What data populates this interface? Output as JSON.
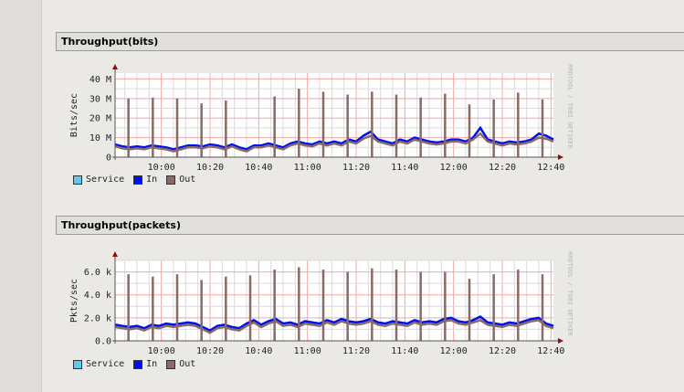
{
  "colors": {
    "service": "#5ec8f0",
    "in": "#0010f0",
    "out": "#8a6a66",
    "major_grid": "#f0a8a8",
    "minor_grid": "#dcdcdc",
    "axis": "#8a1010"
  },
  "watermark": "RRDTOOL / TOBI OETIKER",
  "legend": [
    {
      "key": "service",
      "label": "Service"
    },
    {
      "key": "in",
      "label": "In"
    },
    {
      "key": "out",
      "label": "Out"
    }
  ],
  "chart_data": [
    {
      "type": "line",
      "title": "Throughput(bits)",
      "ylabel": "Bits/sec",
      "xlim": [
        581,
        761
      ],
      "ylim": [
        0,
        43
      ],
      "yticks": [
        {
          "v": 0,
          "label": "0"
        },
        {
          "v": 10,
          "label": "10 M"
        },
        {
          "v": 20,
          "label": "20 M"
        },
        {
          "v": 30,
          "label": "30 M"
        },
        {
          "v": 40,
          "label": "40 M"
        }
      ],
      "xticks": [
        {
          "v": 600,
          "label": "10:00"
        },
        {
          "v": 620,
          "label": "10:20"
        },
        {
          "v": 640,
          "label": "10:40"
        },
        {
          "v": 660,
          "label": "11:00"
        },
        {
          "v": 680,
          "label": "11:20"
        },
        {
          "v": 700,
          "label": "11:40"
        },
        {
          "v": 720,
          "label": "12:00"
        },
        {
          "v": 740,
          "label": "12:20"
        },
        {
          "v": 760,
          "label": "12:40"
        }
      ],
      "x_start": 581,
      "x_step": 3,
      "in": [
        6.5,
        5.5,
        5,
        5.5,
        5,
        6,
        5.5,
        5,
        4,
        5,
        6,
        6,
        5.5,
        6.5,
        6,
        5,
        6.5,
        5,
        4,
        6,
        6,
        7,
        6,
        5,
        7,
        8,
        7,
        6.5,
        8,
        7,
        8,
        7,
        9,
        8,
        11,
        13,
        9,
        8,
        7,
        9,
        8,
        10,
        9,
        8,
        7.5,
        8,
        9,
        9,
        8,
        10,
        15,
        9,
        8,
        7,
        8,
        7.5,
        8,
        9,
        12,
        11,
        9
      ],
      "out": [
        5.5,
        4.5,
        4,
        4.5,
        4,
        5,
        4.5,
        4,
        3,
        4,
        5,
        5,
        4.5,
        5.5,
        5,
        4,
        5.5,
        4,
        3,
        5,
        5,
        6,
        5,
        4,
        6,
        7,
        6,
        5.5,
        7,
        6,
        7,
        6,
        8,
        7,
        9.5,
        11,
        8,
        7,
        6,
        8,
        7,
        9,
        8,
        7,
        6.5,
        7,
        8,
        8,
        7,
        9,
        12,
        8,
        7,
        6,
        7,
        6.5,
        7,
        8,
        10,
        9.5,
        8
      ],
      "spikes": [
        {
          "t": 586.5,
          "v": 30
        },
        {
          "t": 596.5,
          "v": 30.5
        },
        {
          "t": 606.5,
          "v": 30
        },
        {
          "t": 616.5,
          "v": 27.5
        },
        {
          "t": 626.5,
          "v": 29
        },
        {
          "t": 646.5,
          "v": 31
        },
        {
          "t": 656.5,
          "v": 35
        },
        {
          "t": 666.5,
          "v": 33.5
        },
        {
          "t": 676.5,
          "v": 32
        },
        {
          "t": 686.5,
          "v": 33.5
        },
        {
          "t": 696.5,
          "v": 32
        },
        {
          "t": 706.5,
          "v": 30.5
        },
        {
          "t": 716.5,
          "v": 32.5
        },
        {
          "t": 726.5,
          "v": 27
        },
        {
          "t": 736.5,
          "v": 29.5
        },
        {
          "t": 746.5,
          "v": 33
        },
        {
          "t": 756.5,
          "v": 29.5
        }
      ]
    },
    {
      "type": "line",
      "title": "Throughput(packets)",
      "ylabel": "Pkts/sec",
      "xlim": [
        581,
        761
      ],
      "ylim": [
        0,
        7
      ],
      "yticks": [
        {
          "v": 0,
          "label": "0.0"
        },
        {
          "v": 2,
          "label": "2.0 k"
        },
        {
          "v": 4,
          "label": "4.0 k"
        },
        {
          "v": 6,
          "label": "6.0 k"
        }
      ],
      "xticks": [
        {
          "v": 600,
          "label": "10:00"
        },
        {
          "v": 620,
          "label": "10:20"
        },
        {
          "v": 640,
          "label": "10:40"
        },
        {
          "v": 660,
          "label": "11:00"
        },
        {
          "v": 680,
          "label": "11:20"
        },
        {
          "v": 700,
          "label": "11:40"
        },
        {
          "v": 720,
          "label": "12:00"
        },
        {
          "v": 740,
          "label": "12:20"
        },
        {
          "v": 760,
          "label": "12:40"
        }
      ],
      "x_start": 581,
      "x_step": 3,
      "in": [
        1.4,
        1.3,
        1.2,
        1.3,
        1.1,
        1.4,
        1.3,
        1.5,
        1.4,
        1.5,
        1.6,
        1.5,
        1.2,
        0.9,
        1.3,
        1.4,
        1.2,
        1.1,
        1.5,
        1.8,
        1.4,
        1.7,
        1.9,
        1.5,
        1.6,
        1.4,
        1.7,
        1.6,
        1.5,
        1.8,
        1.6,
        1.9,
        1.7,
        1.6,
        1.7,
        1.9,
        1.6,
        1.5,
        1.7,
        1.6,
        1.5,
        1.8,
        1.6,
        1.7,
        1.6,
        1.9,
        2,
        1.7,
        1.6,
        1.8,
        2.1,
        1.6,
        1.5,
        1.4,
        1.6,
        1.5,
        1.7,
        1.9,
        2,
        1.5,
        1.3
      ],
      "out": [
        1.2,
        1.1,
        1,
        1.1,
        0.9,
        1.2,
        1.1,
        1.3,
        1.2,
        1.3,
        1.4,
        1.3,
        1,
        0.7,
        1.1,
        1.2,
        1,
        0.9,
        1.3,
        1.6,
        1.2,
        1.5,
        1.7,
        1.3,
        1.4,
        1.2,
        1.5,
        1.4,
        1.3,
        1.6,
        1.4,
        1.7,
        1.5,
        1.4,
        1.5,
        1.7,
        1.4,
        1.3,
        1.5,
        1.4,
        1.3,
        1.6,
        1.4,
        1.5,
        1.4,
        1.7,
        1.8,
        1.5,
        1.4,
        1.6,
        1.8,
        1.4,
        1.3,
        1.2,
        1.4,
        1.3,
        1.5,
        1.7,
        1.8,
        1.3,
        1.1
      ],
      "spikes": [
        {
          "t": 586.5,
          "v": 5.8
        },
        {
          "t": 596.5,
          "v": 5.6
        },
        {
          "t": 606.5,
          "v": 5.8
        },
        {
          "t": 616.5,
          "v": 5.3
        },
        {
          "t": 626.5,
          "v": 5.6
        },
        {
          "t": 636.5,
          "v": 5.7
        },
        {
          "t": 646.5,
          "v": 6.2
        },
        {
          "t": 656.5,
          "v": 6.4
        },
        {
          "t": 666.5,
          "v": 6.2
        },
        {
          "t": 676.5,
          "v": 6.0
        },
        {
          "t": 686.5,
          "v": 6.3
        },
        {
          "t": 696.5,
          "v": 6.2
        },
        {
          "t": 706.5,
          "v": 6.0
        },
        {
          "t": 716.5,
          "v": 6.0
        },
        {
          "t": 726.5,
          "v": 5.4
        },
        {
          "t": 736.5,
          "v": 5.8
        },
        {
          "t": 746.5,
          "v": 6.2
        },
        {
          "t": 756.5,
          "v": 5.8
        }
      ]
    }
  ]
}
